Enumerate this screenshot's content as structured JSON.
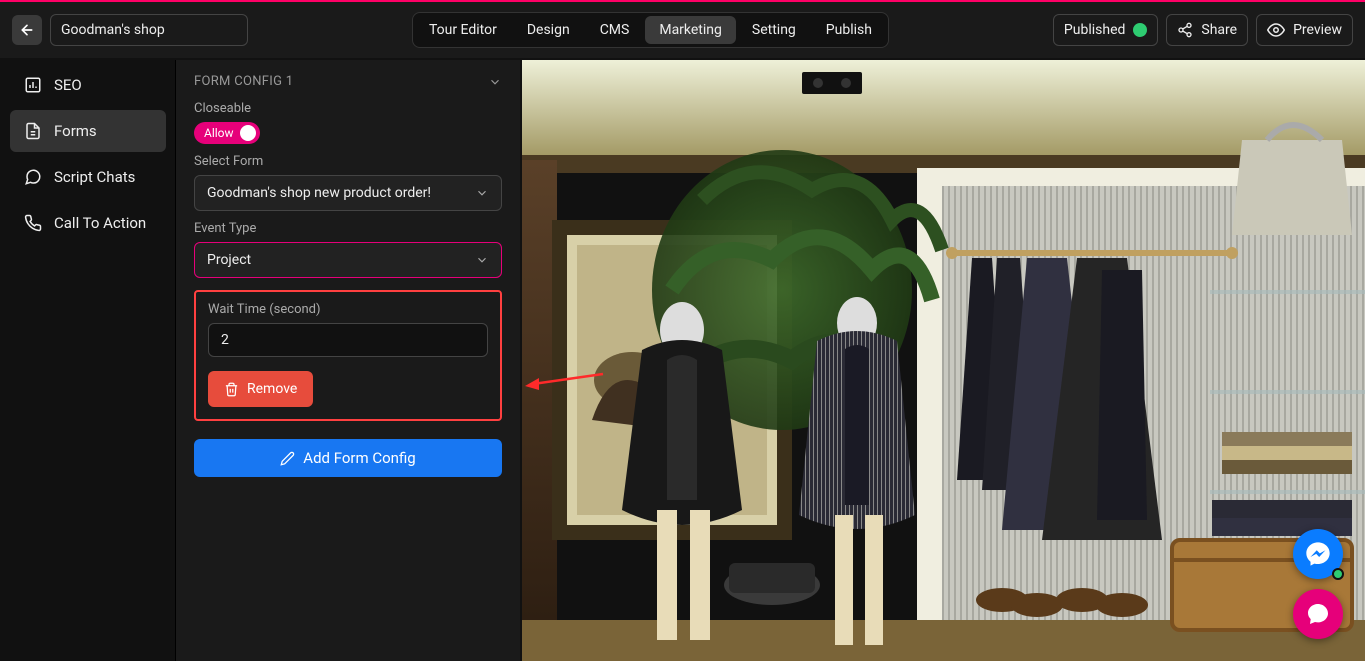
{
  "header": {
    "title_value": "Goodman's shop",
    "tabs": [
      "Tour Editor",
      "Design",
      "CMS",
      "Marketing",
      "Setting",
      "Publish"
    ],
    "active_tab_index": 3,
    "status_label": "Published",
    "share_label": "Share",
    "preview_label": "Preview"
  },
  "sidebar": {
    "items": [
      {
        "label": "SEO"
      },
      {
        "label": "Forms"
      },
      {
        "label": "Script Chats"
      },
      {
        "label": "Call To Action"
      }
    ],
    "active_index": 1
  },
  "panel": {
    "section_title": "FORM CONFIG 1",
    "closeable_label": "Closeable",
    "toggle_label": "Allow",
    "select_form_label": "Select Form",
    "select_form_value": "Goodman's shop new product order!",
    "event_type_label": "Event Type",
    "event_type_value": "Project",
    "wait_time_label": "Wait Time (second)",
    "wait_time_value": "2",
    "remove_label": "Remove",
    "add_label": "Add Form Config"
  }
}
